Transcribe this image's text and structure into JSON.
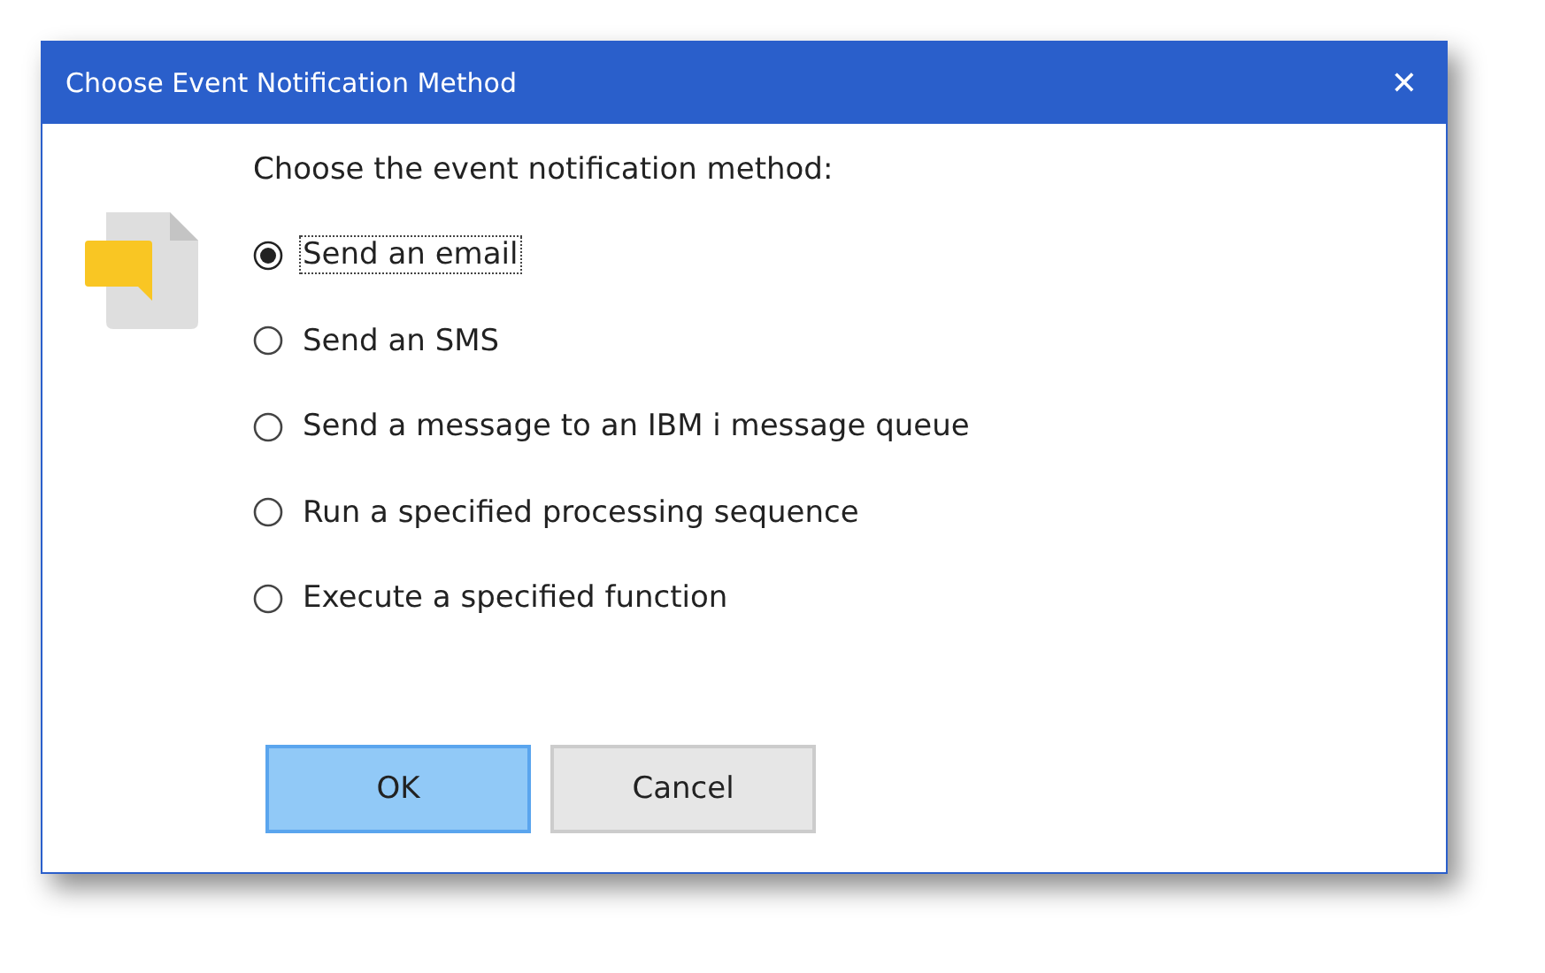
{
  "window": {
    "title": "Choose Event Notification Method",
    "close": "✕"
  },
  "prompt": "Choose the event notification method:",
  "options": [
    {
      "label": "Send an email",
      "selected": true
    },
    {
      "label": "Send an SMS",
      "selected": false
    },
    {
      "label": "Send a message to an IBM i message queue",
      "selected": false
    },
    {
      "label": "Run a specified processing sequence",
      "selected": false
    },
    {
      "label": "Execute a specified function",
      "selected": false
    }
  ],
  "buttons": [
    {
      "label": "OK",
      "default": true
    },
    {
      "label": "Cancel",
      "default": false
    }
  ]
}
